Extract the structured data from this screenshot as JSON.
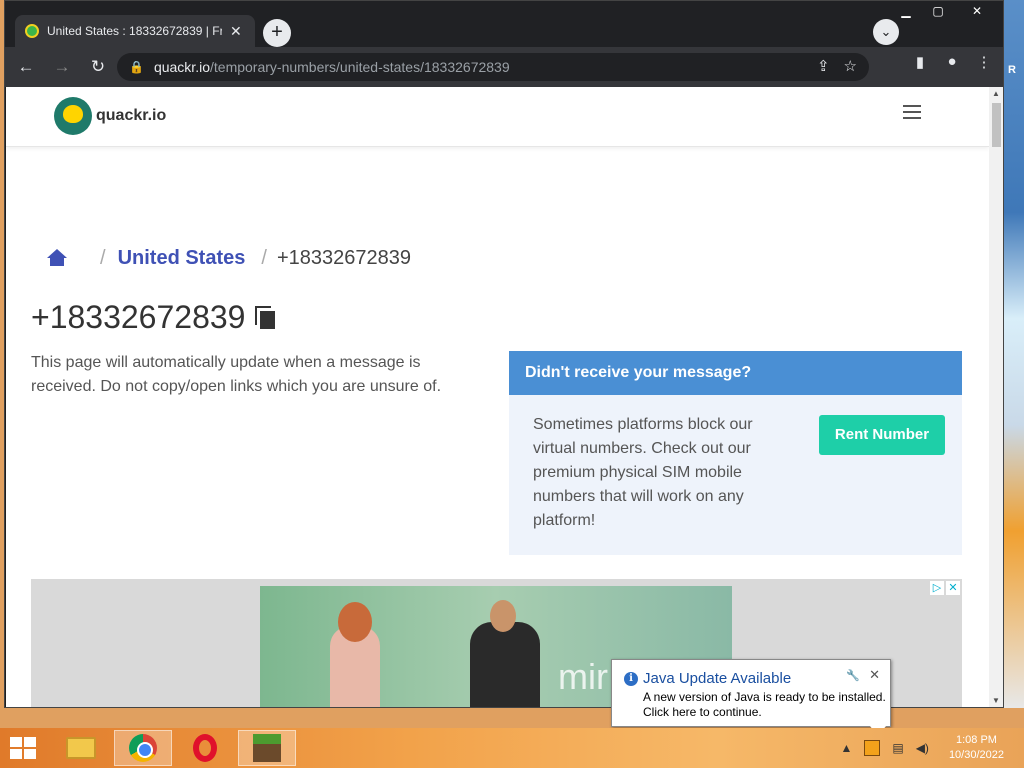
{
  "browser": {
    "tab_title": "United States : 18332672839 | Fr",
    "new_tab": "+",
    "tab_search": "⌄",
    "url_host": "quackr.io",
    "url_path": "/temporary-numbers/united-states/18332672839"
  },
  "site": {
    "logo_text": "quackr.io",
    "breadcrumb": {
      "country": "United States",
      "sep": "/",
      "current": "+18332672839"
    },
    "number": "+18332672839",
    "info_text": "This page will automatically update when a message is received. Do not copy/open links which you are unsure of.",
    "card": {
      "heading": "Didn't receive your message?",
      "body": "Sometimes platforms block our virtual numbers. Check out our premium physical SIM mobile numbers that will work on any platform!",
      "button": "Rent Number"
    },
    "ad": {
      "word": "mir"
    }
  },
  "notification": {
    "title": "Java Update Available",
    "body_line1": "A new version of Java is ready to be installed.",
    "body_line2": "Click here to continue."
  },
  "taskbar": {
    "time": "1:08 PM",
    "date": "10/30/2022"
  },
  "colors": {
    "accent": "#3f51b5",
    "card_header": "#4a8fd4",
    "rent_button": "#1ecfa8"
  }
}
